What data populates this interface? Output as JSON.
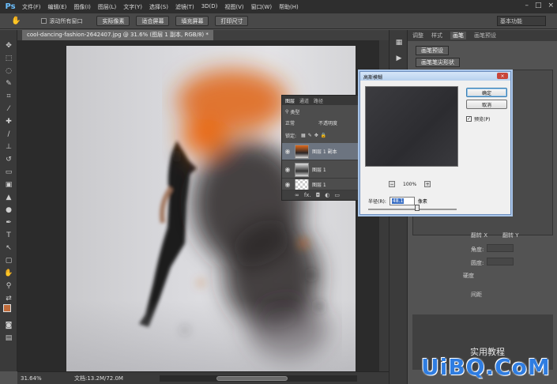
{
  "app": {
    "logo": "Ps"
  },
  "menu": [
    "文件(F)",
    "编辑(E)",
    "图像(I)",
    "图层(L)",
    "文字(Y)",
    "选择(S)",
    "滤镜(T)",
    "3D(D)",
    "视图(V)",
    "窗口(W)",
    "帮助(H)"
  ],
  "window_controls": [
    "–",
    "□",
    "×"
  ],
  "options": {
    "scroll_all_label": "滚动所有窗口",
    "buttons": [
      "实际像素",
      "适合屏幕",
      "填充屏幕",
      "打印尺寸"
    ],
    "workspace": "基本功能"
  },
  "document": {
    "tab_title": "cool-dancing-fashion-2642407.jpg @ 31.6% (图层 1 副本, RGB/8) *",
    "zoom": "31.64%",
    "doc_info": "文档:13.2M/72.0M"
  },
  "right_panel": {
    "tabs": [
      "调整",
      "样式",
      "画笔",
      "画笔预设"
    ],
    "active_tab": "画笔",
    "preset_button": "画笔预设",
    "tip_shape_label": "画笔笔尖形状",
    "flip_x": "翻转 X",
    "flip_y": "翻转 Y",
    "angle_label": "角度:",
    "roundness_label": "圆度:",
    "hardness_label": "硬度",
    "spacing_label": "间距"
  },
  "layers_panel": {
    "tabs": [
      "图层",
      "通道",
      "路径"
    ],
    "active_tab": "图层",
    "kind_label": "类型",
    "blend_mode": "正常",
    "opacity_label": "不透明度",
    "lock_label": "锁定:",
    "layers": [
      {
        "name": "图层 1 副本",
        "active": true
      },
      {
        "name": "图层 1",
        "active": false
      },
      {
        "name": "图层 1",
        "active": false
      }
    ],
    "footer": "fx."
  },
  "dialog": {
    "title": "高斯模糊",
    "close": "×",
    "ok": "确定",
    "cancel": "取消",
    "preview_label": "预览(P)",
    "preview_checked": "✓",
    "zoom_out": "−",
    "zoom_level": "100%",
    "zoom_in": "+",
    "radius_label": "半径(R):",
    "radius_value": "48.1",
    "radius_unit": "像素",
    "radius_slider_fraction": 0.55
  },
  "watermark": {
    "text": "UiBQ.CoM",
    "small_text": "实用教程"
  }
}
